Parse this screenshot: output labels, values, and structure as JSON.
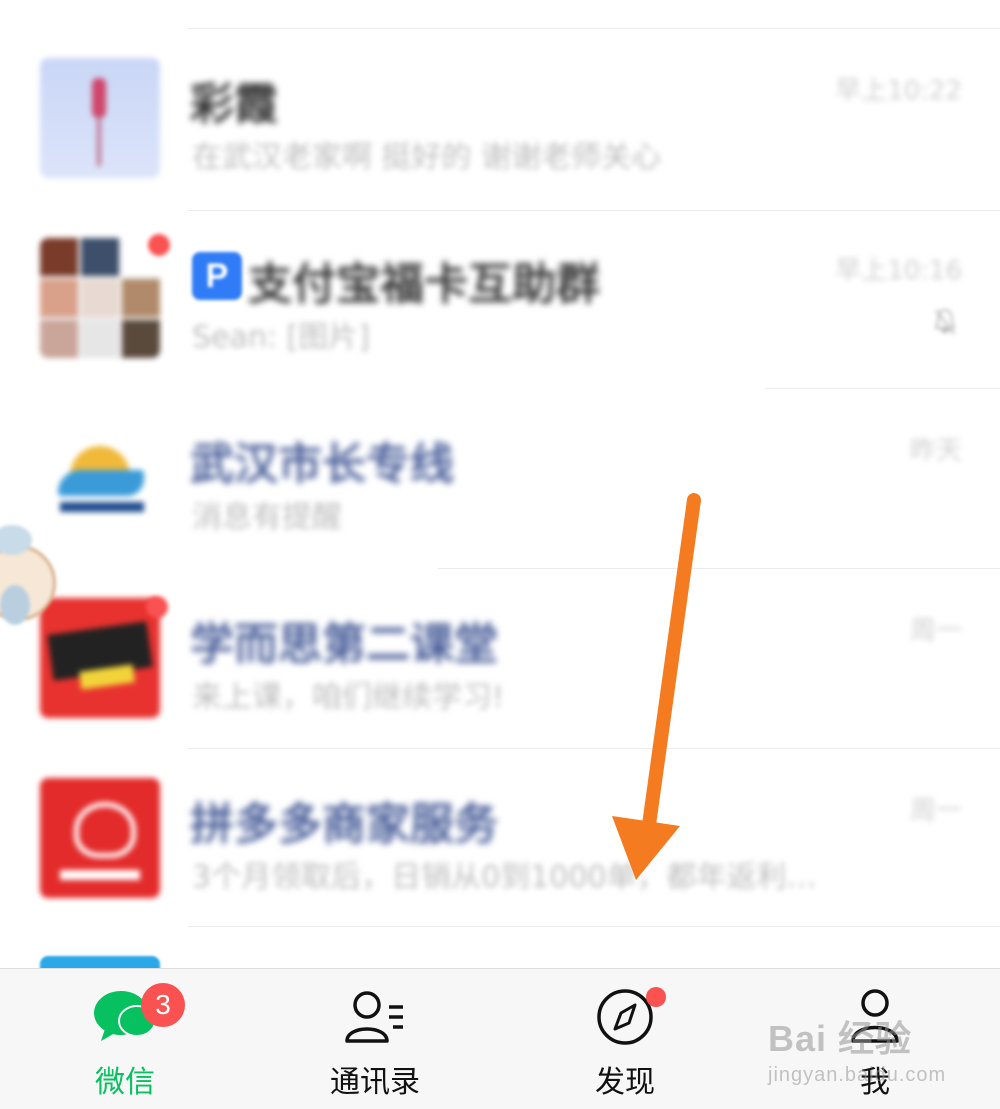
{
  "chats": [
    {
      "name": "彩霞",
      "preview": "在武汉老家啊 挺好的 谢谢老师关心",
      "time": "早上10:22"
    },
    {
      "name": "支付宝福卡互助群",
      "preview": "Sean: [图片]",
      "time": "早上10:16"
    },
    {
      "name": "武汉市长专线",
      "preview": "消息有提醒",
      "time": "昨天"
    },
    {
      "name": "学而思第二课堂",
      "preview": "来上课，咱们继续学习!",
      "time": "周一"
    },
    {
      "name": "拼多多商家服务",
      "preview": "3个月领取后，日销从0到1000单，都年返利…",
      "time": "周一"
    }
  ],
  "tabs": [
    {
      "label": "微信",
      "badge": "3",
      "icon": "chat-bubbles-icon"
    },
    {
      "label": "通讯录",
      "icon": "contacts-icon"
    },
    {
      "label": "发现",
      "icon": "compass-icon"
    },
    {
      "label": "我",
      "icon": "person-icon"
    }
  ],
  "watermark": {
    "main": "Bai 经验",
    "sub": "jingyan.baidu.com"
  },
  "colors": {
    "accent": "#07c160",
    "badge": "#fa5151",
    "arrow": "#f47b20"
  }
}
